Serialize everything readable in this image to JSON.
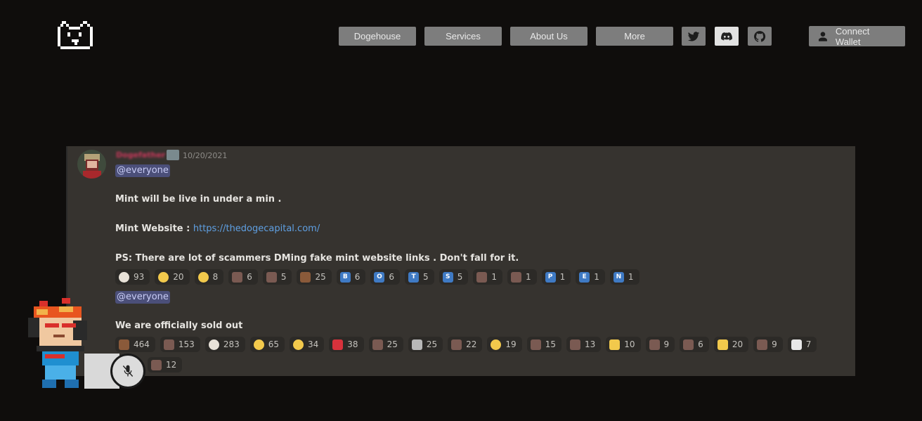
{
  "nav": {
    "items": [
      {
        "label": "Dogehouse"
      },
      {
        "label": "Services"
      },
      {
        "label": "About Us"
      },
      {
        "label": "More"
      }
    ],
    "connect_label": "Connect Wallet"
  },
  "message": {
    "username": "Dogefather",
    "timestamp": "10/20/2021",
    "mention1": "@everyone",
    "line1": "Mint will be live in under a min .",
    "website_label": "Mint Website :",
    "website_link": "https://thedogecapital.com/",
    "warning": "PS: There are lot of scammers DMing fake mint website links . Don't fall for it.",
    "reactions1": [
      {
        "icon": "clown-face",
        "count": "93"
      },
      {
        "icon": "grimacing-face",
        "count": "20"
      },
      {
        "icon": "tired-face",
        "count": "8"
      },
      {
        "icon": "custom-emoji",
        "count": "6"
      },
      {
        "icon": "custom-emoji",
        "count": "5"
      },
      {
        "icon": "pile-of-poo",
        "count": "25"
      },
      {
        "icon": "letter-b",
        "letter": "B",
        "count": "6"
      },
      {
        "icon": "letter-o",
        "letter": "O",
        "count": "6"
      },
      {
        "icon": "letter-t",
        "letter": "T",
        "count": "5"
      },
      {
        "icon": "letter-s",
        "letter": "S",
        "count": "5"
      },
      {
        "icon": "custom-emoji",
        "count": "1"
      },
      {
        "icon": "custom-emoji",
        "count": "1"
      },
      {
        "icon": "letter-p",
        "letter": "P",
        "count": "1"
      },
      {
        "icon": "letter-e",
        "letter": "E",
        "count": "1"
      },
      {
        "icon": "letter-n",
        "letter": "N",
        "count": "1"
      }
    ],
    "mention2": "@everyone",
    "line2": "We are officially sold out",
    "reactions2": [
      {
        "icon": "pile-of-poo",
        "count": "464"
      },
      {
        "icon": "custom-emoji",
        "count": "153"
      },
      {
        "icon": "clown-face",
        "count": "283"
      },
      {
        "icon": "rolling-laughing",
        "count": "65"
      },
      {
        "icon": "smiling-face",
        "count": "34"
      },
      {
        "icon": "red-heart",
        "count": "38"
      },
      {
        "icon": "custom-emoji",
        "count": "25"
      },
      {
        "icon": "knife",
        "count": "25"
      },
      {
        "icon": "custom-emoji",
        "count": "22"
      },
      {
        "icon": "slightly-smiling",
        "count": "19"
      },
      {
        "icon": "custom-emoji",
        "count": "15"
      },
      {
        "icon": "custom-emoji",
        "count": "13"
      },
      {
        "icon": "raising-hands",
        "count": "10"
      },
      {
        "icon": "custom-emoji",
        "count": "9"
      },
      {
        "icon": "custom-emoji",
        "count": "6"
      },
      {
        "icon": "middle-finger",
        "count": "20"
      },
      {
        "icon": "custom-emoji",
        "count": "9"
      },
      {
        "icon": "chart-increasing",
        "count": "7"
      }
    ],
    "reactions3": [
      {
        "icon": "custom-emoji",
        "count": "12"
      }
    ]
  },
  "colors": {
    "background": "#0f0d0c",
    "nav_button": "#7d7d7d",
    "card": "#36332f",
    "mention_bg": "#4b4f79",
    "link": "#5fa0e3",
    "username": "#c8385b"
  }
}
